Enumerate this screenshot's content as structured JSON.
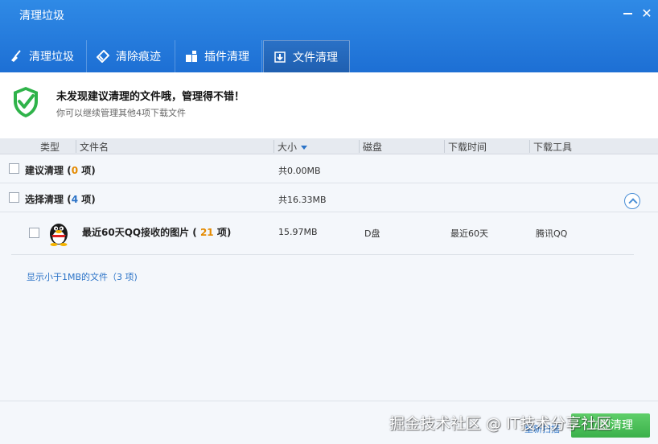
{
  "window": {
    "title": "清理垃圾",
    "close_glyph": "✕"
  },
  "tabs": [
    {
      "label": "清理垃圾",
      "icon": "broom-icon"
    },
    {
      "label": "清除痕迹",
      "icon": "eraser-icon"
    },
    {
      "label": "插件清理",
      "icon": "puzzle-icon"
    },
    {
      "label": "文件清理",
      "icon": "download-file-icon",
      "active": true
    }
  ],
  "status": {
    "title": "未发现建议清理的文件哦，管理得不错！",
    "subtitle": "你可以继续管理其他4项下载文件"
  },
  "columns": {
    "type": "类型",
    "filename": "文件名",
    "size": "大小",
    "disk": "磁盘",
    "time": "下载时间",
    "tool": "下载工具"
  },
  "groups": [
    {
      "label": "建议清理",
      "open_paren": " (",
      "count": "0",
      "suffix": " 项)",
      "size": "共0.00MB"
    },
    {
      "label": "选择清理",
      "open_paren": " (",
      "count": "4",
      "suffix": " 项)",
      "size": "共16.33MB"
    }
  ],
  "item": {
    "name": "最近60天QQ接收的图片",
    "open_paren": " ( ",
    "count": "21",
    "suffix": " 项)",
    "size": "15.97MB",
    "disk": "D盘",
    "time": "最近60天",
    "tool": "腾讯QQ"
  },
  "links": {
    "small_files": "显示小于1MB的文件（3 项)"
  },
  "footer": {
    "rescan": "重新扫描",
    "primary_button": "立即清理"
  },
  "watermark": "掘金技术社区 @ IT技术分享社区",
  "colors": {
    "titlebar": "#2f8ae6",
    "accent": "#2b73c7",
    "count_orange": "#e48a00",
    "shield_green": "#2fb34a"
  }
}
